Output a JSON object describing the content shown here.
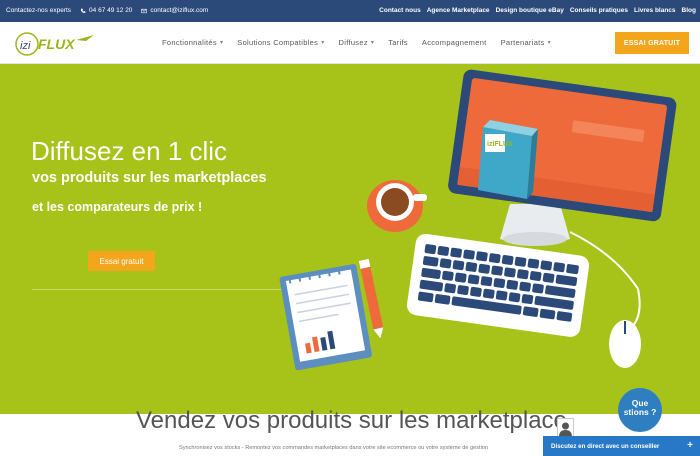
{
  "topbar": {
    "contact_label": "Contactez-nos experts",
    "phone": "04 67 49 12 20",
    "email": "contact@iziflux.com",
    "links": [
      "Contact nous",
      "Agence Marketplace",
      "Design boutique eBay",
      "Conseils pratiques",
      "Livres blancs",
      "Blog"
    ]
  },
  "header": {
    "logo_prefix": "izi",
    "logo_main": "FLUX",
    "nav": [
      {
        "label": "Fonctionnalités",
        "caret": true
      },
      {
        "label": "Solutions Compatibles",
        "caret": true
      },
      {
        "label": "Diffusez",
        "caret": true
      },
      {
        "label": "Tarifs",
        "caret": false
      },
      {
        "label": "Accompagnement",
        "caret": false
      },
      {
        "label": "Partenariats",
        "caret": true
      }
    ],
    "cta": "ESSAI GRATUIT"
  },
  "hero": {
    "title": "Diffusez en 1 clic",
    "line1": "vos produits sur les marketplaces",
    "line2": "et les comparateurs de prix !",
    "cta": "Essai gratuit",
    "box_label": "iziFLUX"
  },
  "bottom": {
    "heading": "Vendez vos produits sur les marketplace",
    "subtext": "Synchronisez vos stocks - Remontez vos commandes marketplaces dans votre site ecommerce ou votre système de gestion"
  },
  "chat": {
    "bubble_line1": "Que",
    "bubble_line2": "stions ?",
    "bar_label": "Discutez en direct avec un conseiller",
    "plus": "+"
  },
  "colors": {
    "topbar": "#2b4a7a",
    "hero_green": "#a7c31a",
    "accent_orange": "#f3a51b",
    "chat_blue": "#2878c8"
  }
}
